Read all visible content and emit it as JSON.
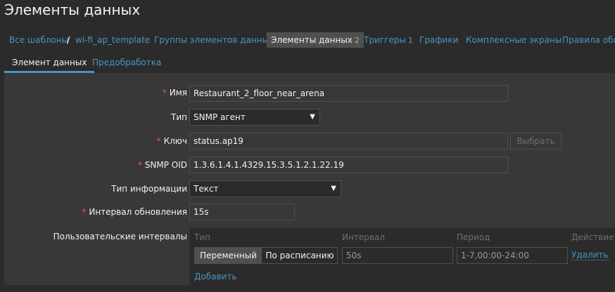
{
  "header": {
    "title": "Элементы данных"
  },
  "nav": {
    "all_templates": "Все шаблоны",
    "separator": "/",
    "template": "wi-fi_ap_template",
    "groups": "Группы элементов данных",
    "items": "Элементы данных",
    "items_count": "2",
    "triggers": "Триггеры",
    "triggers_count": "1",
    "graphs": "Графики",
    "screens": "Комплексные экраны",
    "discovery": "Правила обна"
  },
  "tabs": {
    "item": "Элемент данных",
    "preprocessing": "Предобработка"
  },
  "form": {
    "name_label": "Имя",
    "name_value": "Restaurant_2_floor_near_arena",
    "type_label": "Тип",
    "type_value": "SNMP агент",
    "key_label": "Ключ",
    "key_value": "status.ap19",
    "select_button": "Выбрать",
    "oid_label": "SNMP OID",
    "oid_value": "1.3.6.1.4.1.4329.15.3.5.1.2.1.22.19",
    "info_type_label": "Тип информации",
    "info_type_value": "Текст",
    "interval_label": "Интервал обновления",
    "interval_value": "15s",
    "custom_intervals_label": "Пользовательские интервалы"
  },
  "intervals": {
    "col_type": "Тип",
    "col_interval": "Интервал",
    "col_period": "Период",
    "col_action": "Действие",
    "opt_flexible": "Переменный",
    "opt_scheduling": "По расписанию",
    "interval_value": "50s",
    "period_value": "1-7,00:00-24:00",
    "remove": "Удалить",
    "add": "Добавить"
  }
}
